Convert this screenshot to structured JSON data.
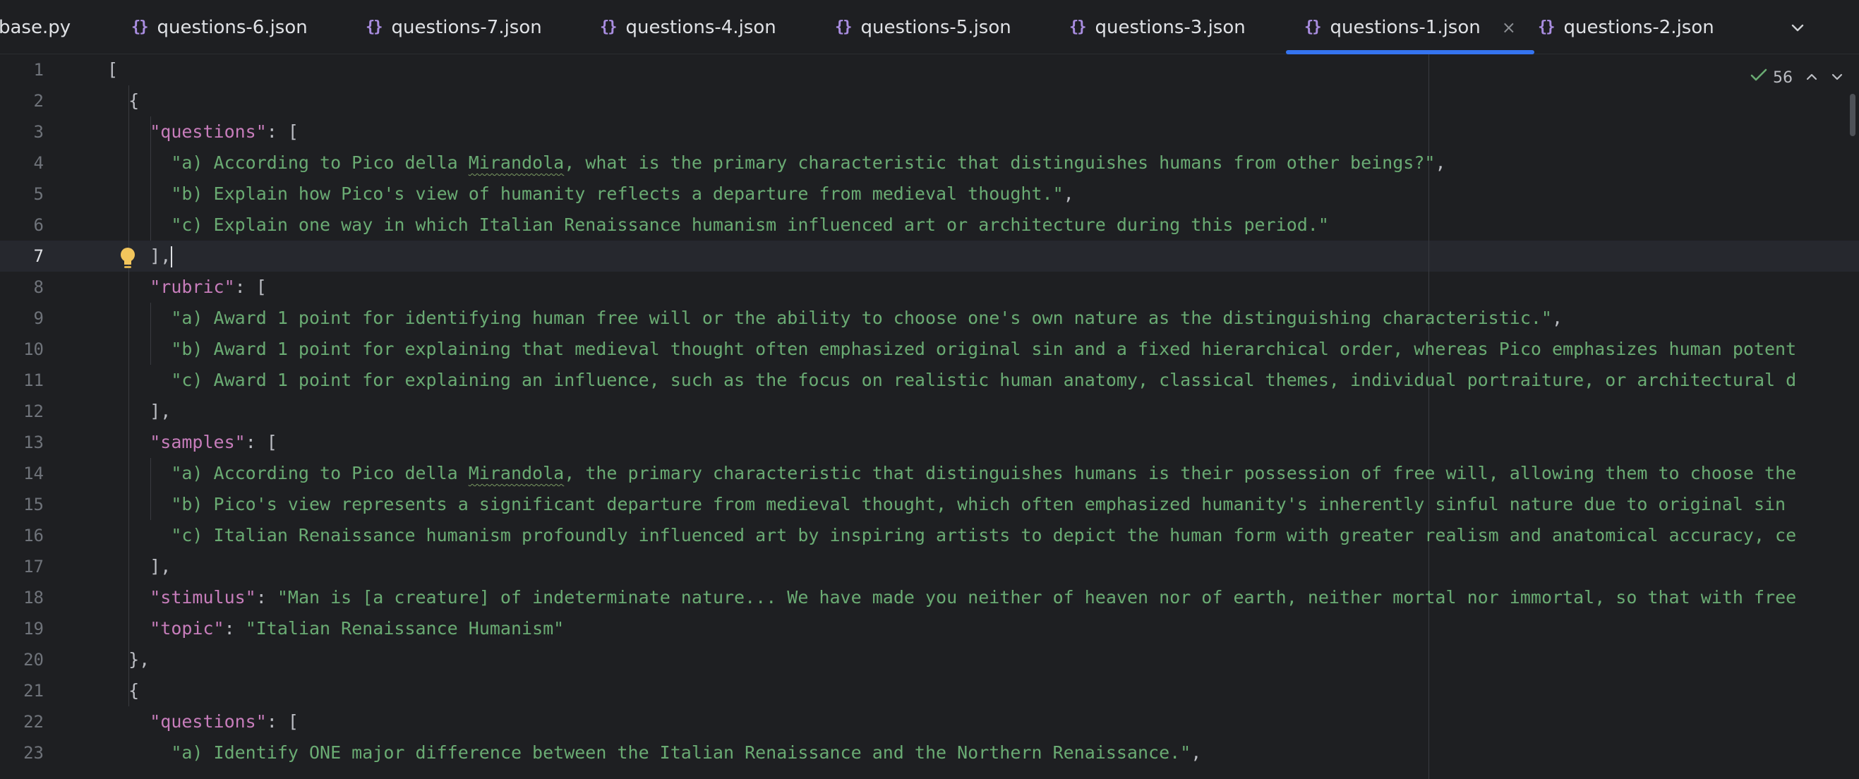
{
  "tabs": [
    {
      "label": "base.py",
      "icon": "python-file-icon",
      "active": false
    },
    {
      "label": "questions-6.json",
      "icon": "json-file-icon",
      "active": false
    },
    {
      "label": "questions-7.json",
      "icon": "json-file-icon",
      "active": false
    },
    {
      "label": "questions-4.json",
      "icon": "json-file-icon",
      "active": false
    },
    {
      "label": "questions-5.json",
      "icon": "json-file-icon",
      "active": false
    },
    {
      "label": "questions-3.json",
      "icon": "json-file-icon",
      "active": false
    },
    {
      "label": "questions-1.json",
      "icon": "json-file-icon",
      "active": true
    },
    {
      "label": "questions-2.json",
      "icon": "json-file-icon",
      "active": false
    }
  ],
  "tab_json_glyph": "{}",
  "tab_close_glyph": "×",
  "tab_menu_glyph": "⌄",
  "inspection": {
    "count": "56",
    "icon": "check-icon",
    "up": "⌃",
    "down": "⌄"
  },
  "current_line": 7,
  "colors": {
    "background": "#1e1f22",
    "key": "#c77dbb",
    "string": "#6aab73",
    "punctuation": "#bcbec4",
    "active_tab_underline": "#3574f0",
    "line_number": "#6f737a"
  },
  "lines": [
    {
      "n": "1",
      "tokens": [
        {
          "t": "p",
          "v": "["
        }
      ]
    },
    {
      "n": "2",
      "tokens": [
        {
          "t": "p",
          "v": "  {"
        }
      ]
    },
    {
      "n": "3",
      "tokens": [
        {
          "t": "p",
          "v": "    "
        },
        {
          "t": "k",
          "v": "\"questions\""
        },
        {
          "t": "p",
          "v": ": ["
        }
      ]
    },
    {
      "n": "4",
      "tokens": [
        {
          "t": "p",
          "v": "      "
        },
        {
          "t": "s",
          "v": "\"a) According to Pico della "
        },
        {
          "t": "sq",
          "v": "Mirandola"
        },
        {
          "t": "s",
          "v": ", what is the primary characteristic that distinguishes humans from other beings?\""
        },
        {
          "t": "p",
          "v": ","
        }
      ]
    },
    {
      "n": "5",
      "tokens": [
        {
          "t": "p",
          "v": "      "
        },
        {
          "t": "s",
          "v": "\"b) Explain how Pico's view of humanity reflects a departure from medieval thought.\""
        },
        {
          "t": "p",
          "v": ","
        }
      ]
    },
    {
      "n": "6",
      "tokens": [
        {
          "t": "p",
          "v": "      "
        },
        {
          "t": "s",
          "v": "\"c) Explain one way in which Italian Renaissance humanism influenced art or architecture during this period.\""
        }
      ]
    },
    {
      "n": "7",
      "tokens": [
        {
          "t": "p",
          "v": "    ],"
        },
        {
          "t": "caret",
          "v": ""
        }
      ]
    },
    {
      "n": "8",
      "tokens": [
        {
          "t": "p",
          "v": "    "
        },
        {
          "t": "k",
          "v": "\"rubric\""
        },
        {
          "t": "p",
          "v": ": ["
        }
      ]
    },
    {
      "n": "9",
      "tokens": [
        {
          "t": "p",
          "v": "      "
        },
        {
          "t": "s",
          "v": "\"a) Award 1 point for identifying human free will or the ability to choose one's own nature as the distinguishing characteristic.\""
        },
        {
          "t": "p",
          "v": ","
        }
      ]
    },
    {
      "n": "10",
      "tokens": [
        {
          "t": "p",
          "v": "      "
        },
        {
          "t": "s",
          "v": "\"b) Award 1 point for explaining that medieval thought often emphasized original sin and a fixed hierarchical order, whereas Pico emphasizes human potent"
        }
      ]
    },
    {
      "n": "11",
      "tokens": [
        {
          "t": "p",
          "v": "      "
        },
        {
          "t": "s",
          "v": "\"c) Award 1 point for explaining an influence, such as the focus on realistic human anatomy, classical themes, individual portraiture, or architectural d"
        }
      ]
    },
    {
      "n": "12",
      "tokens": [
        {
          "t": "p",
          "v": "    ],"
        }
      ]
    },
    {
      "n": "13",
      "tokens": [
        {
          "t": "p",
          "v": "    "
        },
        {
          "t": "k",
          "v": "\"samples\""
        },
        {
          "t": "p",
          "v": ": ["
        }
      ]
    },
    {
      "n": "14",
      "tokens": [
        {
          "t": "p",
          "v": "      "
        },
        {
          "t": "s",
          "v": "\"a) According to Pico della "
        },
        {
          "t": "sq",
          "v": "Mirandola"
        },
        {
          "t": "s",
          "v": ", the primary characteristic that distinguishes humans is their possession of free will, allowing them to choose the"
        }
      ]
    },
    {
      "n": "15",
      "tokens": [
        {
          "t": "p",
          "v": "      "
        },
        {
          "t": "s",
          "v": "\"b) Pico's view represents a significant departure from medieval thought, which often emphasized humanity's inherently sinful nature due to original sin"
        }
      ]
    },
    {
      "n": "16",
      "tokens": [
        {
          "t": "p",
          "v": "      "
        },
        {
          "t": "s",
          "v": "\"c) Italian Renaissance humanism profoundly influenced art by inspiring artists to depict the human form with greater realism and anatomical accuracy, ce"
        }
      ]
    },
    {
      "n": "17",
      "tokens": [
        {
          "t": "p",
          "v": "    ],"
        }
      ]
    },
    {
      "n": "18",
      "tokens": [
        {
          "t": "p",
          "v": "    "
        },
        {
          "t": "k",
          "v": "\"stimulus\""
        },
        {
          "t": "p",
          "v": ": "
        },
        {
          "t": "s",
          "v": "\"Man is [a creature] of indeterminate nature... We have made you neither of heaven nor of earth, neither mortal nor immortal, so that with free"
        }
      ]
    },
    {
      "n": "19",
      "tokens": [
        {
          "t": "p",
          "v": "    "
        },
        {
          "t": "k",
          "v": "\"topic\""
        },
        {
          "t": "p",
          "v": ": "
        },
        {
          "t": "s",
          "v": "\"Italian Renaissance Humanism\""
        }
      ]
    },
    {
      "n": "20",
      "tokens": [
        {
          "t": "p",
          "v": "  },"
        }
      ]
    },
    {
      "n": "21",
      "tokens": [
        {
          "t": "p",
          "v": "  {"
        }
      ]
    },
    {
      "n": "22",
      "tokens": [
        {
          "t": "p",
          "v": "    "
        },
        {
          "t": "k",
          "v": "\"questions\""
        },
        {
          "t": "p",
          "v": ": ["
        }
      ]
    },
    {
      "n": "23",
      "tokens": [
        {
          "t": "p",
          "v": "      "
        },
        {
          "t": "s",
          "v": "\"a) Identify ONE major difference between the Italian Renaissance and the Northern Renaissance.\""
        },
        {
          "t": "p",
          "v": ","
        }
      ]
    }
  ]
}
